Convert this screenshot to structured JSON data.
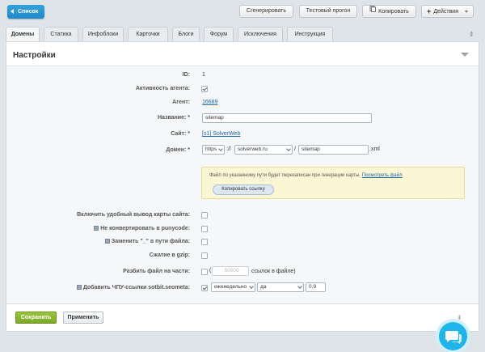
{
  "toolbar": {
    "back_label": "Список",
    "generate_label": "Сгенерировать",
    "test_label": "Тестовый прогон",
    "copy_label": "Копировать",
    "actions_label": "Действия"
  },
  "tabs": [
    "Домены",
    "Статика",
    "Инфоблоки",
    "Карточки",
    "Блоги",
    "Форум",
    "Исключения",
    "Инструкция"
  ],
  "panel": {
    "title": "Настройки"
  },
  "form": {
    "id_label": "ID:",
    "id_value": "1",
    "active_label": "Активность агента:",
    "active_checked": true,
    "agent_label": "Агент:",
    "agent_value": "16689",
    "name_label": "Название:",
    "required_mark": "*",
    "name_value": "sitemap",
    "site_label": "Сайт:",
    "site_value": "[s1] SolverWeb",
    "domain_label": "Домен:",
    "domain_protocol": "https",
    "domain_sep1": "://",
    "domain_host": "solverweb.ru",
    "domain_sep2": "/",
    "domain_file": "sitemap",
    "domain_ext": ".xml",
    "note_text": "Файл по указанному пути будет перезаписан при генерации карты.",
    "note_link": "Посмотреть файл",
    "note_button": "Копировать ссылку",
    "pretty_label": "Включить удобный вывод карты сайта:",
    "punycode_label": "Не конвертировать в punycode:",
    "replace_label": "Заменить \"_\" в пути файла:",
    "gzip_label": "Сжатие в gzip:",
    "split_label": "Разбить файл на части:",
    "split_placeholder": "50000",
    "split_suffix": "ссылок в файле)",
    "split_prefix": "(",
    "seo_label": "Добавить ЧПУ-ссылки sotbit.seometa:",
    "seo_checked": true,
    "seo_freq": "еженедельно",
    "seo_yes": "да",
    "seo_priority": "0,9"
  },
  "footer": {
    "save_label": "Сохранить",
    "apply_label": "Применить"
  },
  "colors": {
    "accent": "#1f88c9",
    "save": "#8ab530",
    "link": "#2067b0",
    "note_bg": "#fbf6d3"
  }
}
